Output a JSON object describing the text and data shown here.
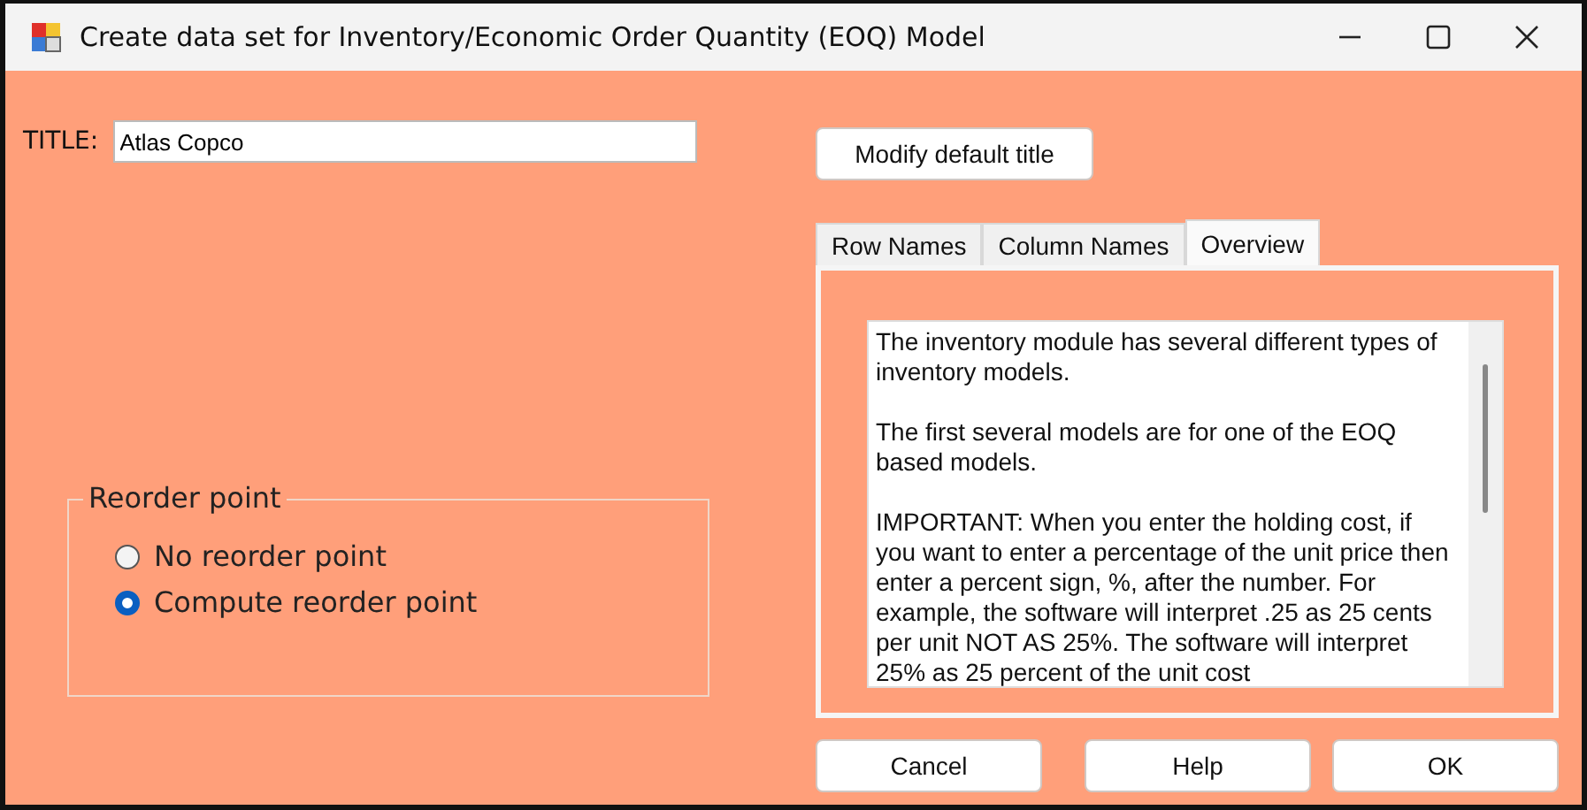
{
  "window": {
    "title": "Create data set for Inventory/Economic Order Quantity (EOQ) Model"
  },
  "title_field": {
    "label": "TITLE:",
    "value": "Atlas Copco"
  },
  "modify_button": "Modify default title",
  "tabs": [
    {
      "label": "Row Names",
      "selected": false
    },
    {
      "label": "Column Names",
      "selected": false
    },
    {
      "label": "Overview",
      "selected": true
    }
  ],
  "overview": {
    "paragraphs": [
      "The inventory module has several different types of inventory models.",
      "The first several models are for one of the EOQ based models.",
      "IMPORTANT: When you enter the holding cost, if you want to enter a percentage of the unit price then enter a percent sign, %, after the number. For example, the software will interpret .25 as 25 cents per unit NOT AS 25%. The software will interpret 25% as 25 percent of the unit cost"
    ]
  },
  "reorder_group": {
    "legend": "Reorder point",
    "options": [
      {
        "label": "No reorder point",
        "selected": false
      },
      {
        "label": "Compute reorder point",
        "selected": true
      }
    ]
  },
  "buttons": [
    "Cancel",
    "Help",
    "OK"
  ]
}
